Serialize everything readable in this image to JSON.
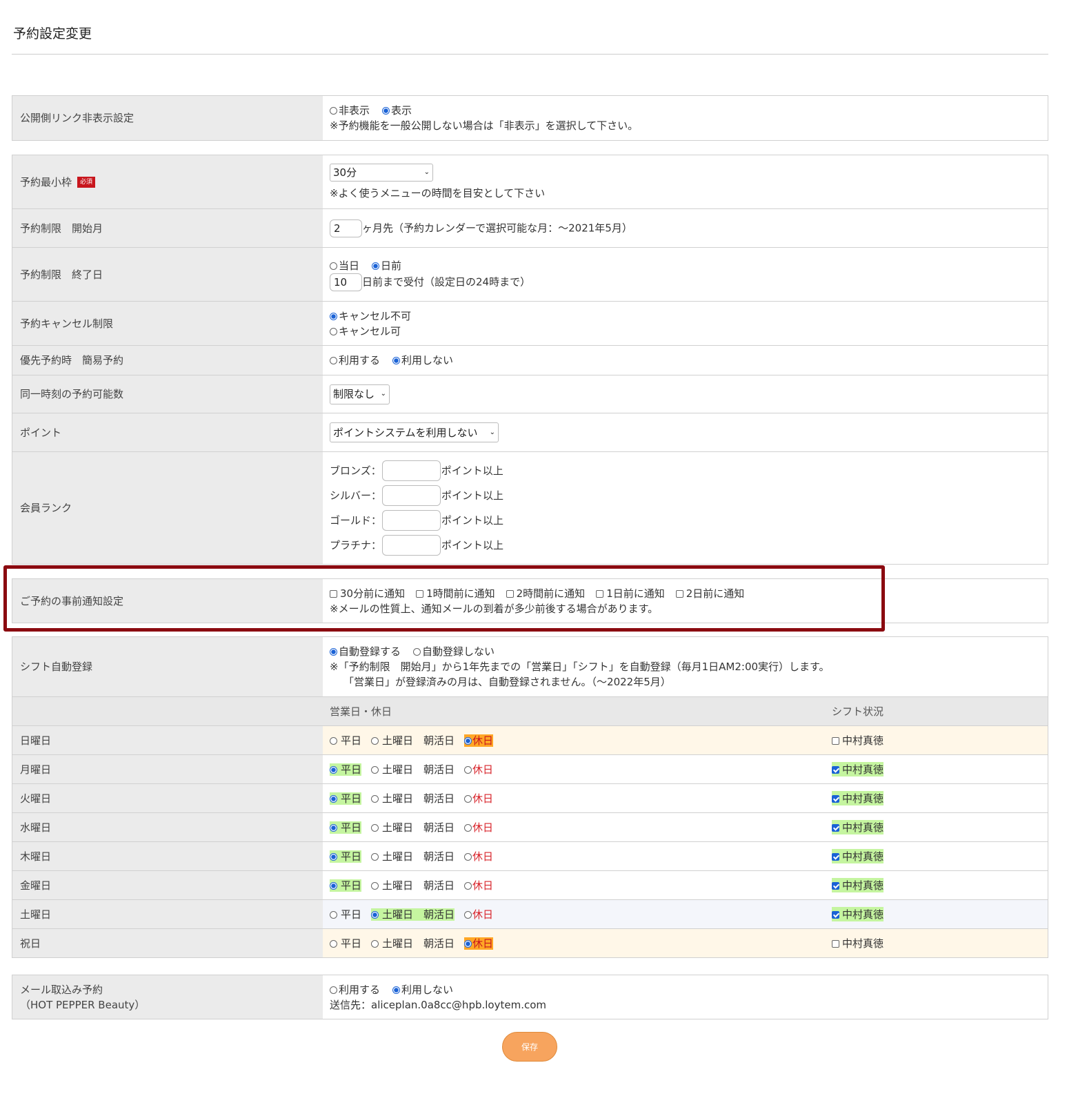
{
  "page": {
    "title": "予約設定変更"
  },
  "link_visibility": {
    "label": "公開側リンク非表示設定",
    "options": [
      "非表示",
      "表示"
    ],
    "selected": 1,
    "note": "※予約機能を一般公開しない場合は「非表示」を選択して下さい。"
  },
  "min_slot": {
    "label": "予約最小枠",
    "required_badge": "必須",
    "value": "30分",
    "note": "※よく使うメニューの時間を目安として下さい"
  },
  "start_month": {
    "label": "予約制限　開始月",
    "value": "2",
    "suffix": "ヶ月先（予約カレンダーで選択可能な月：〜2021年5月）"
  },
  "end_day": {
    "label": "予約制限　終了日",
    "options": [
      "当日",
      "日前"
    ],
    "selected": 1,
    "value": "10",
    "suffix": "日前まで受付（設定日の24時まで）"
  },
  "cancel": {
    "label": "予約キャンセル制限",
    "options": [
      "キャンセル不可",
      "キャンセル可"
    ],
    "selected": 0
  },
  "priority": {
    "label": "優先予約時　簡易予約",
    "options": [
      "利用する",
      "利用しない"
    ],
    "selected": 1
  },
  "concurrent": {
    "label": "同一時刻の予約可能数",
    "value": "制限なし"
  },
  "point": {
    "label": "ポイント",
    "value": "ポイントシステムを利用しない"
  },
  "member_rank": {
    "label": "会員ランク",
    "suffix": "ポイント以上",
    "ranks": [
      "ブロンズ：",
      "シルバー：",
      "ゴールド：",
      "プラチナ："
    ]
  },
  "notify": {
    "label": "ご予約の事前通知設定",
    "options": [
      "30分前に通知",
      "1時間前に通知",
      "2時間前に通知",
      "1日前に通知",
      "2日前に通知"
    ],
    "note": "※メールの性質上、通知メールの到着が多少前後する場合があります。"
  },
  "shift_auto": {
    "label": "シフト自動登録",
    "options": [
      "自動登録する",
      "自動登録しない"
    ],
    "selected": 0,
    "note1": "※「予約制限　開始月」から1年先までの「営業日」「シフト」を自動登録（毎月1日AM2:00実行）します。",
    "note2": "「営業日」が登録済みの月は、自動登録されません。（〜2022年5月）"
  },
  "schedule": {
    "col_business": "営業日・休日",
    "col_shift": "シフト状況",
    "options": [
      "平日",
      "土曜日　朝活日",
      "休日"
    ],
    "staff": "中村真徳",
    "days": [
      {
        "name": "日曜日",
        "selected": 2,
        "shift": false
      },
      {
        "name": "月曜日",
        "selected": 0,
        "shift": true
      },
      {
        "name": "火曜日",
        "selected": 0,
        "shift": true
      },
      {
        "name": "水曜日",
        "selected": 0,
        "shift": true
      },
      {
        "name": "木曜日",
        "selected": 0,
        "shift": true
      },
      {
        "name": "金曜日",
        "selected": 0,
        "shift": true
      },
      {
        "name": "土曜日",
        "selected": 1,
        "shift": true
      },
      {
        "name": "祝日",
        "selected": 2,
        "shift": false
      }
    ]
  },
  "mail_import": {
    "label_line1": "メール取込み予約",
    "label_line2": "（HOT PEPPER Beauty）",
    "options": [
      "利用する",
      "利用しない"
    ],
    "selected": 1,
    "address": "送信先：aliceplan.0a8cc@hpb.loytem.com"
  },
  "save_label": "保存",
  "colors": {
    "highlight_box": "#8b0a10",
    "save_button": "#f7a45e",
    "selected_green": "#c5f5a0",
    "holiday_orange": "#ffa726"
  }
}
